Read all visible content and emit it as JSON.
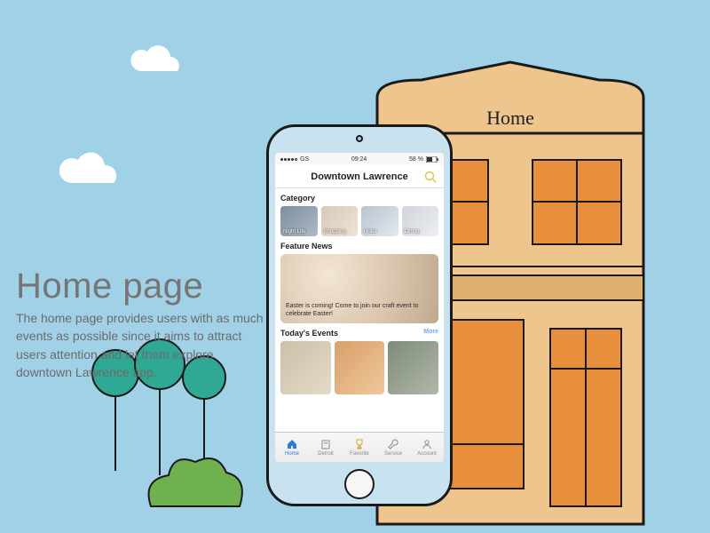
{
  "scene": {
    "building_label": "Home"
  },
  "text": {
    "heading": "Home page",
    "paragraph": "The home page provides users with as much events as possible since it aims to attract users attention and let them explore downtown Lawrence app."
  },
  "phone": {
    "status": {
      "carrier": "GS",
      "time": "09:24",
      "battery": "58 %"
    },
    "navbar": {
      "title": "Downtown Lawrence"
    },
    "sections": {
      "category": {
        "title": "Category",
        "items": [
          "Night Life",
          "Shopping",
          "Hotel",
          "Dining"
        ]
      },
      "feature": {
        "title": "Feature News",
        "caption": "Easter is coming! Come to join our craft event to celebrate Easter!"
      },
      "events": {
        "title": "Today's Events",
        "more": "More"
      }
    },
    "tabs": [
      {
        "label": "Home",
        "active": true
      },
      {
        "label": "Detroit",
        "active": false
      },
      {
        "label": "Favorite",
        "active": false
      },
      {
        "label": "Service",
        "active": false
      },
      {
        "label": "Account",
        "active": false
      }
    ]
  },
  "colors": {
    "sky": "#a1d1e7",
    "building_fill": "#eec58c",
    "building_stroke": "#1a1a1a",
    "window": "#e88f3b",
    "tree": "#2fa894",
    "shrub": "#6fb04f",
    "accent": "#2d7bd6"
  }
}
